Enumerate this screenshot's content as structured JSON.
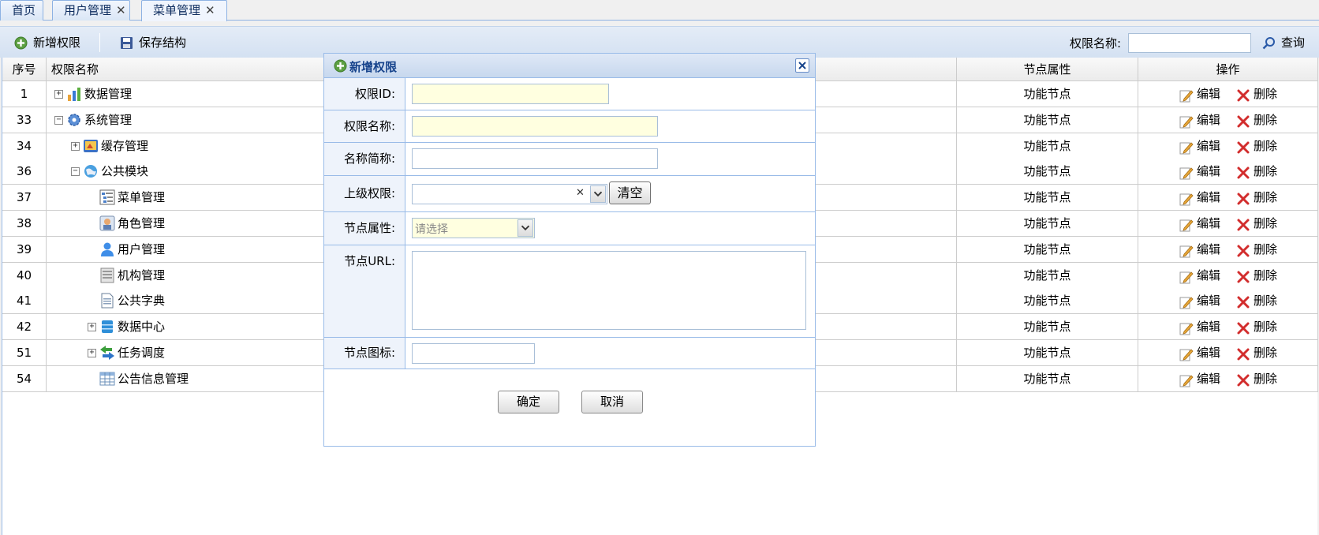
{
  "tabs": [
    {
      "label": "首页",
      "closable": false
    },
    {
      "label": "用户管理",
      "closable": true
    },
    {
      "label": "菜单管理",
      "closable": true,
      "active": true
    }
  ],
  "tab_close_glyph": "✕",
  "toolbar": {
    "add_label": "新增权限",
    "save_label": "保存结构",
    "search_label": "权限名称:",
    "search_value": "",
    "query_label": "查询"
  },
  "grid": {
    "headers": {
      "num": "序号",
      "name": "权限名称",
      "attr": "节点属性",
      "op": "操作"
    },
    "edit_label": "编辑",
    "delete_label": "删除",
    "rows": [
      {
        "num": "1",
        "name": "数据管理",
        "attr": "功能节点",
        "level": 0,
        "expander": "+",
        "icon": "chart-icon"
      },
      {
        "num": "33",
        "name": "系统管理",
        "attr": "功能节点",
        "level": 0,
        "expander": "-",
        "icon": "gear-icon"
      },
      {
        "num": "34",
        "name": "缓存管理",
        "attr": "功能节点",
        "level": 1,
        "expander": "+",
        "icon": "cache-icon"
      },
      {
        "num": "36",
        "name": "公共模块",
        "attr": "功能节点",
        "level": 1,
        "expander": "-",
        "icon": "globe-icon"
      },
      {
        "num": "37",
        "name": "菜单管理",
        "attr": "功能节点",
        "level": 2,
        "expander": "",
        "icon": "menu-tree-icon"
      },
      {
        "num": "38",
        "name": "角色管理",
        "attr": "功能节点",
        "level": 2,
        "expander": "",
        "icon": "role-card-icon"
      },
      {
        "num": "39",
        "name": "用户管理",
        "attr": "功能节点",
        "level": 2,
        "expander": "",
        "icon": "user-icon"
      },
      {
        "num": "40",
        "name": "机构管理",
        "attr": "功能节点",
        "level": 2,
        "expander": "",
        "icon": "org-icon"
      },
      {
        "num": "41",
        "name": "公共字典",
        "attr": "功能节点",
        "level": 2,
        "expander": "",
        "icon": "document-icon"
      },
      {
        "num": "42",
        "name": "数据中心",
        "attr": "功能节点",
        "level": 2,
        "expander": "+",
        "icon": "database-icon"
      },
      {
        "num": "51",
        "name": "任务调度",
        "attr": "功能节点",
        "level": 2,
        "expander": "+",
        "icon": "arrows-icon"
      },
      {
        "num": "54",
        "name": "公告信息管理",
        "attr": "功能节点",
        "level": 2,
        "expander": "",
        "icon": "table-icon"
      }
    ]
  },
  "dialog": {
    "title": "新增权限",
    "fields": {
      "id_label": "权限ID:",
      "name_label": "权限名称:",
      "short_label": "名称简称:",
      "parent_label": "上级权限:",
      "attr_label": "节点属性:",
      "url_label": "节点URL:",
      "icon_label": "节点图标:"
    },
    "clear_label": "清空",
    "clear_glyph": "✕",
    "attr_placeholder": "请选择",
    "ok_label": "确定",
    "cancel_label": "取消"
  }
}
